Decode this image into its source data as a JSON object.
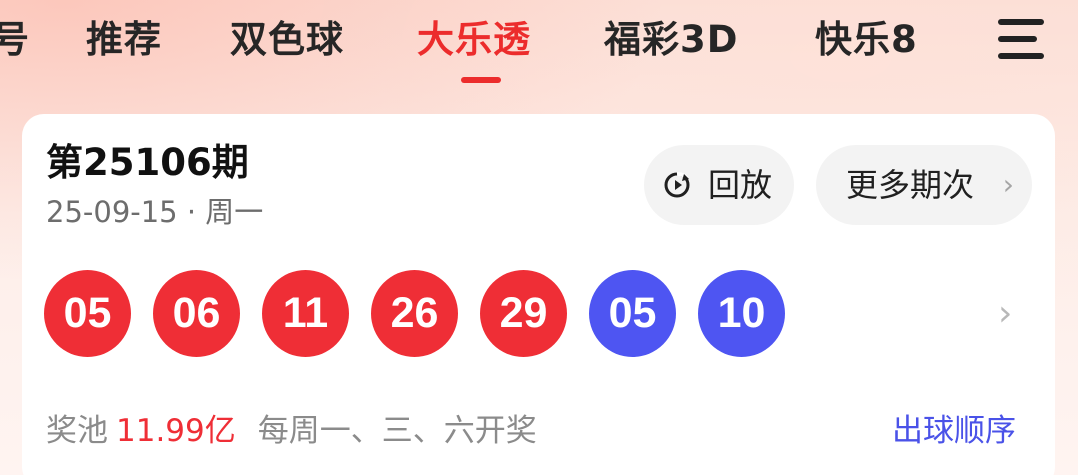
{
  "tabs": [
    {
      "label": "号"
    },
    {
      "label": "推荐"
    },
    {
      "label": "双色球"
    },
    {
      "label": "大乐透"
    },
    {
      "label": "福彩3D"
    },
    {
      "label": "快乐8"
    }
  ],
  "active_tab": "大乐透",
  "draw": {
    "issue": "第25106期",
    "date": "25-09-15 · 周一",
    "replay_label": "回放",
    "more_label": "更多期次",
    "numbers": [
      {
        "value": "05",
        "color": "red"
      },
      {
        "value": "06",
        "color": "red"
      },
      {
        "value": "11",
        "color": "red"
      },
      {
        "value": "26",
        "color": "red"
      },
      {
        "value": "29",
        "color": "red"
      },
      {
        "value": "05",
        "color": "blue"
      },
      {
        "value": "10",
        "color": "blue"
      }
    ],
    "pool_label": "奖池",
    "pool_amount": "11.99亿",
    "schedule": "每周一、三、六开奖",
    "order_link": "出球顺序"
  },
  "icons": {
    "replay": "replay-icon",
    "menu": "menu-icon",
    "chevron": "chevron-right-icon"
  },
  "colors": {
    "accent_red": "#ec2c2c",
    "ball_red": "#ef2e36",
    "ball_blue": "#4e55f2",
    "link_blue": "#4a52e8"
  }
}
